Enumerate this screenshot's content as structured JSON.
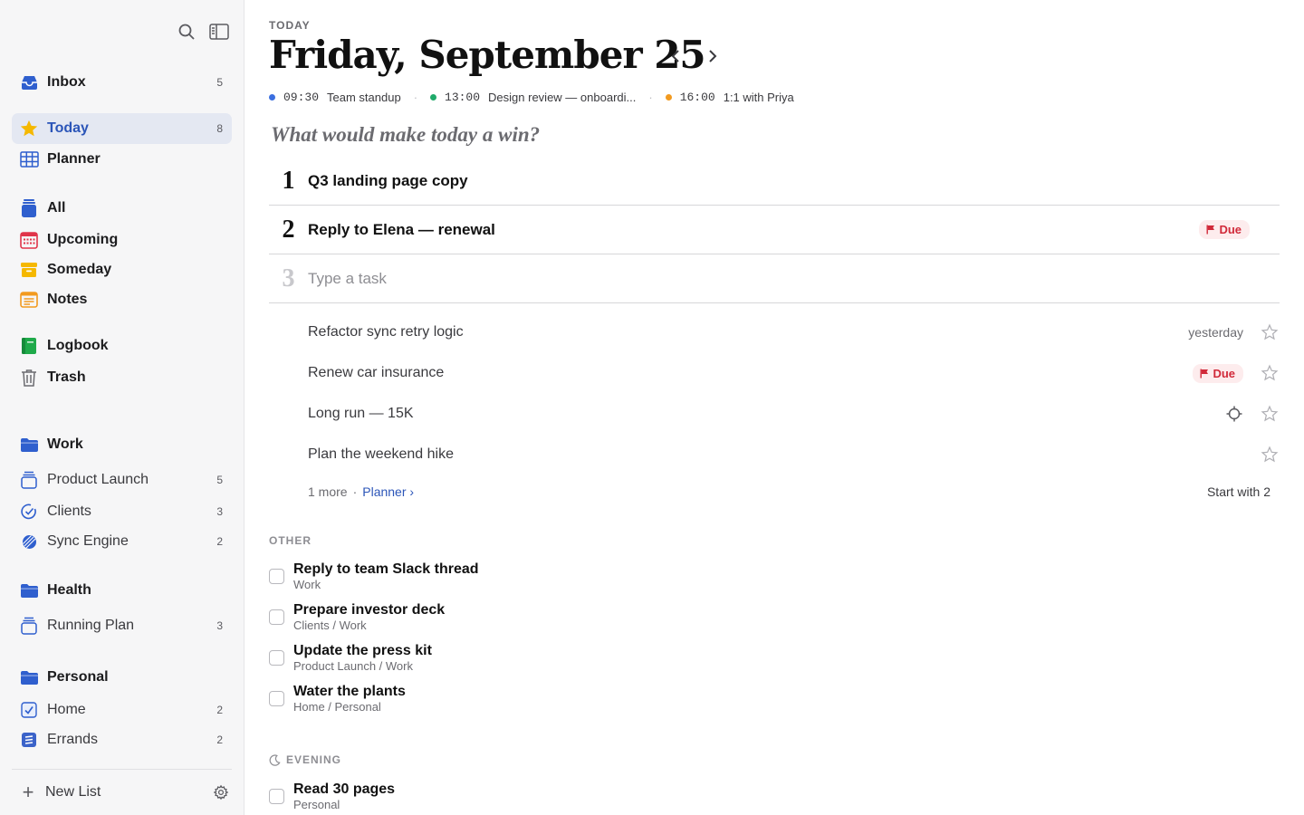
{
  "sidebar": {
    "nav": [
      {
        "label": "Inbox",
        "count": "5",
        "icon": "inbox-icon"
      },
      {
        "label": "Today",
        "count": "8",
        "icon": "star-icon",
        "active": true
      },
      {
        "label": "Planner",
        "count": "",
        "icon": "grid-icon"
      },
      {
        "label": "All",
        "count": "",
        "icon": "stack-icon"
      },
      {
        "label": "Upcoming",
        "count": "",
        "icon": "calendar-icon"
      },
      {
        "label": "Someday",
        "count": "",
        "icon": "tray-icon"
      },
      {
        "label": "Notes",
        "count": "",
        "icon": "notes-icon"
      },
      {
        "label": "Logbook",
        "count": "",
        "icon": "logbook-icon"
      },
      {
        "label": "Trash",
        "count": "",
        "icon": "trash-icon"
      }
    ],
    "areas": [
      {
        "label": "Work"
      },
      {
        "label": "Product Launch",
        "count": "5"
      },
      {
        "label": "Clients",
        "count": "3"
      },
      {
        "label": "Sync Engine",
        "count": "2"
      },
      {
        "label": "Health"
      },
      {
        "label": "Running Plan",
        "count": "3"
      },
      {
        "label": "Personal"
      },
      {
        "label": "Home",
        "count": "2"
      },
      {
        "label": "Errands",
        "count": "2"
      }
    ],
    "new_list_label": "New List"
  },
  "header": {
    "eyebrow": "TODAY",
    "date": "Friday, September 25",
    "events": [
      {
        "time": "09:30",
        "title": "Team standup",
        "color": "#3b6fe0"
      },
      {
        "time": "13:00",
        "title": "Design review — onboardi...",
        "color": "#1faa6a"
      },
      {
        "time": "16:00",
        "title": "1:1 with Priya",
        "color": "#f29a1f"
      }
    ],
    "win_question": "What would make today a win?"
  },
  "priorities": [
    {
      "num": "1",
      "title": "Q3 landing page copy",
      "badge": ""
    },
    {
      "num": "2",
      "title": "Reply to Elena — renewal",
      "badge": "Due"
    },
    {
      "num": "3",
      "placeholder": "Type a task"
    }
  ],
  "today_tasks": [
    {
      "label": "Refactor sync retry logic",
      "meta": "yesterday"
    },
    {
      "label": "Renew car insurance",
      "badge": "Due"
    },
    {
      "label": "Long run — 15K"
    },
    {
      "label": "Plan the weekend hike"
    }
  ],
  "more_row": {
    "more": "1 more",
    "dot": "·",
    "planner": "Planner ›",
    "start": "Start with 2"
  },
  "other": {
    "heading": "OTHER",
    "items": [
      {
        "title": "Reply to team Slack thread",
        "sub": "Work"
      },
      {
        "title": "Prepare investor deck",
        "sub": "Clients / Work"
      },
      {
        "title": "Update the press kit",
        "sub": "Product Launch / Work"
      },
      {
        "title": "Water the plants",
        "sub": "Home / Personal"
      }
    ]
  },
  "evening": {
    "heading": "EVENING",
    "items": [
      {
        "title": "Read 30 pages",
        "sub": "Personal"
      }
    ]
  },
  "colors": {
    "accent": "#2b55b8",
    "due": "#d12a3a",
    "star": "#f5b800"
  }
}
